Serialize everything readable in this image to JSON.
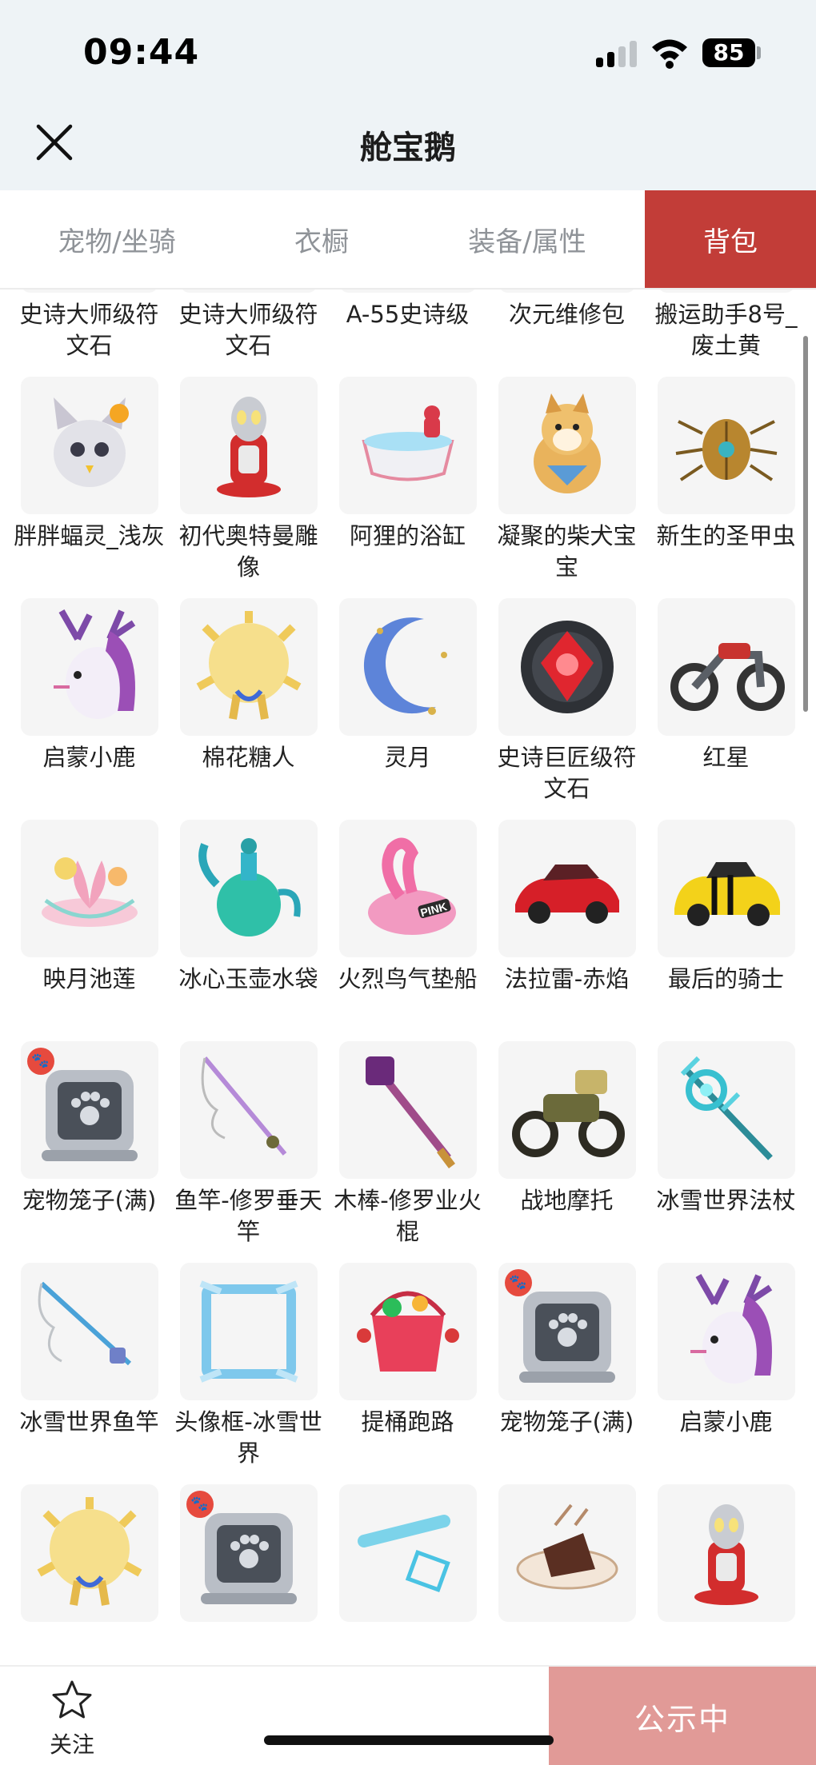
{
  "status_bar": {
    "time": "09:44",
    "battery": "85"
  },
  "nav": {
    "title": "舱宝鹅",
    "close_icon": "close-icon"
  },
  "tabs": [
    {
      "label": "宠物/坐骑",
      "active": false
    },
    {
      "label": "衣橱",
      "active": false
    },
    {
      "label": "装备/属性",
      "active": false
    },
    {
      "label": "背包",
      "active": true
    }
  ],
  "items": [
    {
      "name": "史诗大师级符文石",
      "icon": "rune-stone-icon"
    },
    {
      "name": "史诗大师级符文石",
      "icon": "rune-stone-icon"
    },
    {
      "name": "A-55史诗级",
      "icon": "figure-icon"
    },
    {
      "name": "次元维修包",
      "icon": "repair-bag-icon"
    },
    {
      "name": "搬运助手8号_废土黄",
      "icon": "robot-icon"
    },
    {
      "name": "胖胖蝠灵_浅灰",
      "icon": "bat-spirit-icon"
    },
    {
      "name": "初代奥特曼雕像",
      "icon": "ultraman-statue-icon"
    },
    {
      "name": "阿狸的浴缸",
      "icon": "bathtub-icon"
    },
    {
      "name": "凝聚的柴犬宝宝",
      "icon": "shiba-icon"
    },
    {
      "name": "新生的圣甲虫",
      "icon": "scarab-icon"
    },
    {
      "name": "启蒙小鹿",
      "icon": "deer-icon"
    },
    {
      "name": "棉花糖人",
      "icon": "cotton-candy-man-icon"
    },
    {
      "name": "灵月",
      "icon": "moon-icon"
    },
    {
      "name": "史诗巨匠级符文石",
      "icon": "rune-gem-icon"
    },
    {
      "name": "红星",
      "icon": "motorcycle-icon"
    },
    {
      "name": "映月池莲",
      "icon": "lotus-icon"
    },
    {
      "name": "冰心玉壶水袋",
      "icon": "jade-pot-icon"
    },
    {
      "name": "火烈鸟气垫船",
      "icon": "flamingo-float-icon"
    },
    {
      "name": "法拉雷-赤焰",
      "icon": "red-car-icon"
    },
    {
      "name": "最后的骑士",
      "icon": "yellow-car-icon"
    },
    {
      "name": "宠物笼子(满)",
      "icon": "pet-cage-icon",
      "badge": true
    },
    {
      "name": "鱼竿-修罗垂天竿",
      "icon": "fishing-rod-icon"
    },
    {
      "name": "木棒-修罗业火棍",
      "icon": "staff-icon"
    },
    {
      "name": "战地摩托",
      "icon": "war-motorcycle-icon"
    },
    {
      "name": "冰雪世界法杖",
      "icon": "ice-staff-icon"
    },
    {
      "name": "冰雪世界鱼竿",
      "icon": "ice-fishing-rod-icon"
    },
    {
      "name": "头像框-冰雪世界",
      "icon": "avatar-frame-icon"
    },
    {
      "name": "提桶跑路",
      "icon": "bucket-icon"
    },
    {
      "name": "宠物笼子(满)",
      "icon": "pet-cage-icon",
      "badge": true
    },
    {
      "name": "启蒙小鹿",
      "icon": "deer-icon"
    },
    {
      "name": "",
      "icon": "cotton-candy-man-icon"
    },
    {
      "name": "",
      "icon": "pet-cage-icon",
      "badge": true
    },
    {
      "name": "",
      "icon": "tool-icon"
    },
    {
      "name": "",
      "icon": "cake-icon"
    },
    {
      "name": "",
      "icon": "ultraman-statue-icon"
    }
  ],
  "bottom": {
    "follow_label": "关注",
    "public_label": "公示中"
  },
  "colors": {
    "accent": "#c23d38",
    "public_button": "#e19a97",
    "status_bg": "#eef3f6"
  }
}
